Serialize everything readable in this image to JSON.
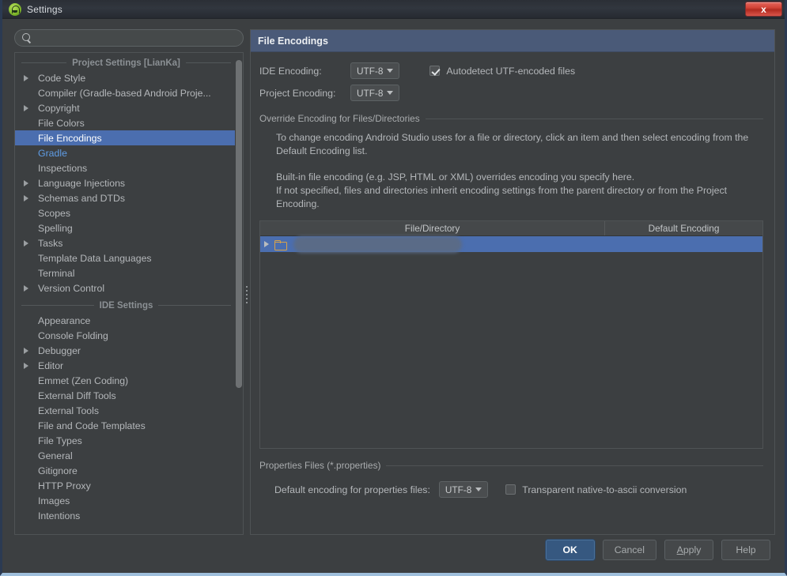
{
  "window": {
    "title": "Settings",
    "app_icon": "android-studio-icon",
    "close_label": "x",
    "accent_blue": "#4b6eaf",
    "header_blue": "#4a5a78",
    "background": "#3c3f41"
  },
  "search": {
    "placeholder": "",
    "value": "",
    "icon": "search-icon"
  },
  "sidebar": {
    "groups": [
      {
        "title": "Project Settings [LianKa]",
        "items": [
          {
            "label": "Code Style",
            "expandable": true,
            "selected": false,
            "modified": false
          },
          {
            "label": "Compiler (Gradle-based Android Proje...",
            "expandable": false,
            "selected": false,
            "modified": false
          },
          {
            "label": "Copyright",
            "expandable": true,
            "selected": false,
            "modified": false
          },
          {
            "label": "File Colors",
            "expandable": false,
            "selected": false,
            "modified": false
          },
          {
            "label": "File Encodings",
            "expandable": false,
            "selected": true,
            "modified": false
          },
          {
            "label": "Gradle",
            "expandable": false,
            "selected": false,
            "modified": true
          },
          {
            "label": "Inspections",
            "expandable": false,
            "selected": false,
            "modified": false
          },
          {
            "label": "Language Injections",
            "expandable": true,
            "selected": false,
            "modified": false
          },
          {
            "label": "Schemas and DTDs",
            "expandable": true,
            "selected": false,
            "modified": false
          },
          {
            "label": "Scopes",
            "expandable": false,
            "selected": false,
            "modified": false
          },
          {
            "label": "Spelling",
            "expandable": false,
            "selected": false,
            "modified": false
          },
          {
            "label": "Tasks",
            "expandable": true,
            "selected": false,
            "modified": false
          },
          {
            "label": "Template Data Languages",
            "expandable": false,
            "selected": false,
            "modified": false
          },
          {
            "label": "Terminal",
            "expandable": false,
            "selected": false,
            "modified": false
          },
          {
            "label": "Version Control",
            "expandable": true,
            "selected": false,
            "modified": false
          }
        ]
      },
      {
        "title": "IDE Settings",
        "items": [
          {
            "label": "Appearance",
            "expandable": false,
            "selected": false,
            "modified": false
          },
          {
            "label": "Console Folding",
            "expandable": false,
            "selected": false,
            "modified": false
          },
          {
            "label": "Debugger",
            "expandable": true,
            "selected": false,
            "modified": false
          },
          {
            "label": "Editor",
            "expandable": true,
            "selected": false,
            "modified": false
          },
          {
            "label": "Emmet (Zen Coding)",
            "expandable": false,
            "selected": false,
            "modified": false
          },
          {
            "label": "External Diff Tools",
            "expandable": false,
            "selected": false,
            "modified": false
          },
          {
            "label": "External Tools",
            "expandable": false,
            "selected": false,
            "modified": false
          },
          {
            "label": "File and Code Templates",
            "expandable": false,
            "selected": false,
            "modified": false
          },
          {
            "label": "File Types",
            "expandable": false,
            "selected": false,
            "modified": false
          },
          {
            "label": "General",
            "expandable": false,
            "selected": false,
            "modified": false
          },
          {
            "label": "Gitignore",
            "expandable": false,
            "selected": false,
            "modified": false
          },
          {
            "label": "HTTP Proxy",
            "expandable": false,
            "selected": false,
            "modified": false
          },
          {
            "label": "Images",
            "expandable": false,
            "selected": false,
            "modified": false
          },
          {
            "label": "Intentions",
            "expandable": false,
            "selected": false,
            "modified": false
          }
        ]
      }
    ]
  },
  "panel": {
    "title": "File Encodings",
    "ide_encoding_label": "IDE Encoding:",
    "ide_encoding_value": "UTF-8",
    "project_encoding_label": "Project Encoding:",
    "project_encoding_value": "UTF-8",
    "autodetect_label": "Autodetect UTF-encoded files",
    "autodetect_checked": true,
    "override_section_title": "Override Encoding for Files/Directories",
    "paragraph_1": "To change encoding Android Studio uses for a file or directory, click an item and then select encoding from the Default Encoding list.",
    "paragraph_2": "Built-in file encoding (e.g. JSP, HTML or XML) overrides encoding you specify here.",
    "paragraph_3": "If not specified, files and directories inherit encoding settings from the parent directory or from the Project Encoding.",
    "table": {
      "columns": [
        "File/Directory",
        "Default Encoding"
      ],
      "rows": [
        {
          "file_directory": "",
          "default_encoding": "",
          "redacted": true,
          "selected": true,
          "expandable": true,
          "icon": "folder-icon"
        }
      ]
    },
    "properties_section_title": "Properties Files (*.properties)",
    "properties_default_label": "Default encoding for properties files:",
    "properties_default_value": "UTF-8",
    "transparent_label": "Transparent native-to-ascii conversion",
    "transparent_checked": false
  },
  "buttons": {
    "ok": "OK",
    "cancel": "Cancel",
    "apply_pre": "A",
    "apply_post": "pply",
    "help": "Help"
  }
}
